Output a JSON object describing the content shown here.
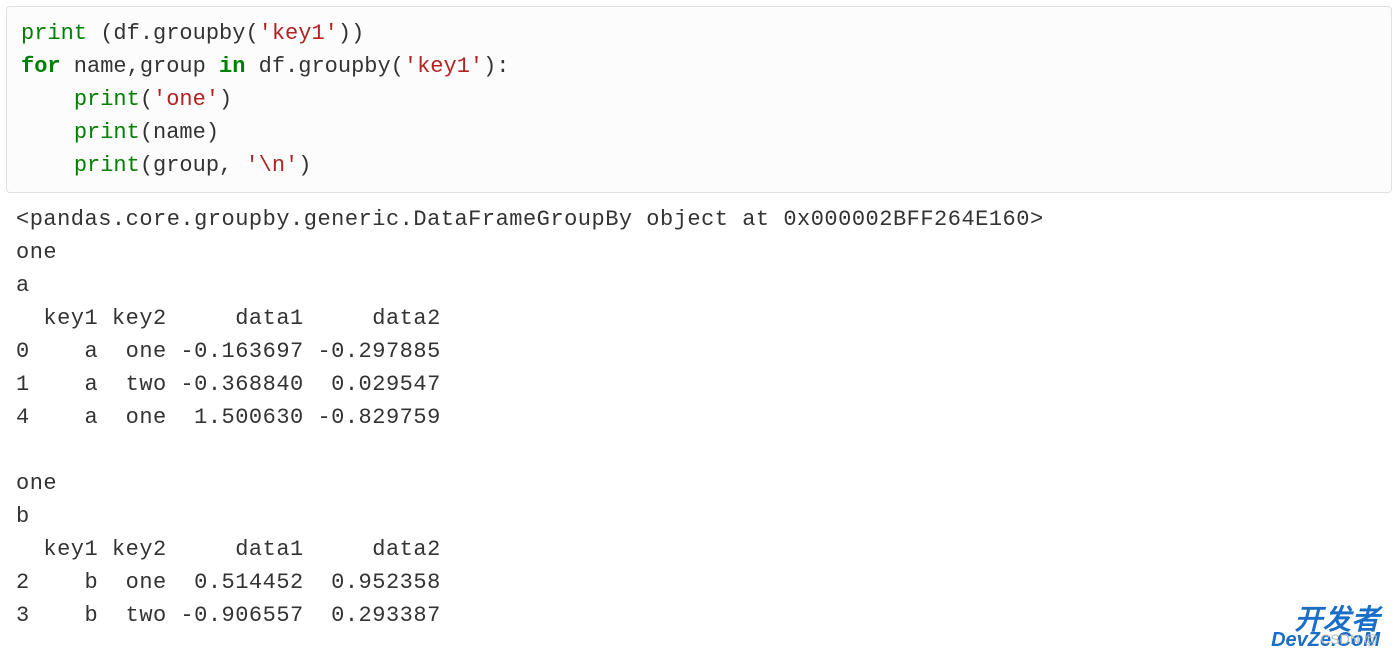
{
  "code": {
    "line1": {
      "print": "print",
      "open": " (df.groupby(",
      "str": "'key1'",
      "close": "))"
    },
    "line2": {
      "for": "for",
      "mid": " name,group ",
      "in": "in",
      "rest": " df.groupby(",
      "str": "'key1'",
      "close": "):"
    },
    "line3": {
      "indent": "    ",
      "print": "print",
      "open": "(",
      "str": "'one'",
      "close": ")"
    },
    "line4": {
      "indent": "    ",
      "print": "print",
      "rest": "(name)"
    },
    "line5": {
      "indent": "    ",
      "print": "print",
      "open": "(group, ",
      "str": "'\\n'",
      "close": ")"
    }
  },
  "output": "<pandas.core.groupby.generic.DataFrameGroupBy object at 0x000002BFF264E160>\none\na\n  key1 key2     data1     data2\n0    a  one -0.163697 -0.297885\n1    a  two -0.368840  0.029547\n4    a  one  1.500630 -0.829759 \n\none\nb\n  key1 key2     data1     data2\n2    b  one  0.514452  0.952358\n3    b  two -0.906557  0.293387 ",
  "watermark1": "开发者",
  "watermark2": "DevZe.CoM",
  "watermark3": "CSDN @"
}
